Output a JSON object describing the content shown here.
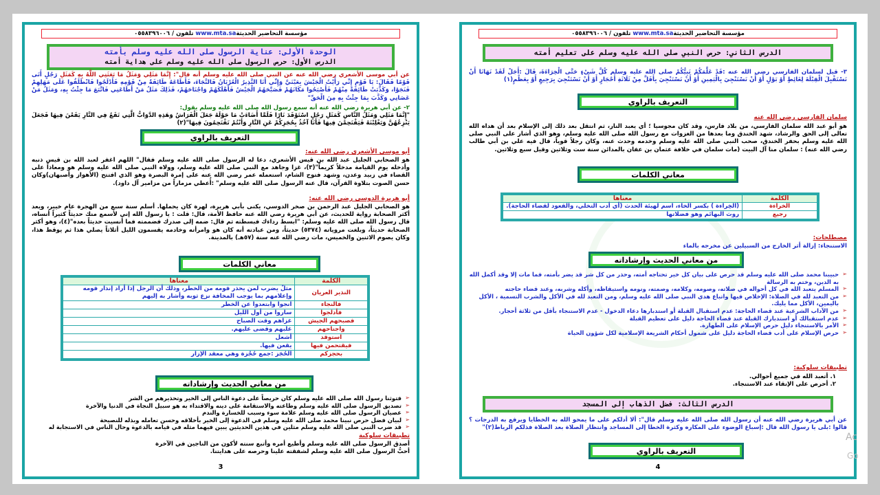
{
  "header": {
    "site": "www.mta.sa",
    "text": "مؤسسة التحاضير الحديثة",
    "phone": "تلفون / ٠٥٥٨٣٩٦٠٠٦"
  },
  "left_page": {
    "unit_title": "الوحدة الأولى: عناية الرسول صلى الله عليه وسلم بأمته",
    "unit_label": "الوحدة الأولى:",
    "lesson_title": "الدرس الأول: حرص الرسول صلى الله عليه وسلم على هداية أمته",
    "hadith1_intro": "عن أبي موسى الأشعري رضي الله عنه عن النبي صلى الله عليه وسلم أنه قال\": إِنَّمَا مَثَلِي وَمَثَلُ مَا بَعَثَنِي اللَّهُ بِهِ كَمَثَلِ",
    "hadith1_body": "رَجُلٍ أَتَى قَوْمًا فَقَالَ: يَا قَوْمِ إِنِّي رَأَيْتُ الْجَيْشَ بِعَيْنَيَّ وَإِنِّي أَنَا النَّذِيرُ الْعُرْيَانُ فَالنَّجَاءَ، فَأَطَاعَهُ طَائِفَةٌ مِنْ قَوْمِهِ فَأَدْلَجُوا فَانْطَلَقُوا عَلَى مَهَلِهِمْ فَنَجَوْا، وَكَذَّبَتْ طَائِفَةٌ مِنْهُمْ فَأَصْبَحُوا مَكَانَهُمْ فَصَبَّحَهُمُ الْجَيْشُ فَأَهْلَكَهُمْ وَاجْتَاحَهُمْ، فَذَلِكَ مَثَلُ مَنْ أَطَاعَنِي فَاتَّبَعَ مَا جِئْتُ بِهِ، وَمَثَلُ مَنْ عَصَانِي وَكَذَّبَ بِمَا جِئْتُ بِهِ مِنَ الْحَقِّ\"",
    "hadith2_intro": "٢- عن أبي هريرة رضي الله عنه أنه سمع رسول الله صلى الله عليه وسلم يقول:",
    "hadith2_body": "\"إِنَّمَا مَثَلِي وَمَثَلُ النَّاسِ كَمَثَلِ رَجُلٍ اسْتَوْقَدَ نَارًا فَلَمَّا أَضَاءَتْ مَا حَوْلَهُ جَعَلَ الْفَرَاشُ وَهَذِهِ الدَّوَابُّ الَّتِي تَقَعُ فِي النَّارِ يَقَعْنَ فِيهَا فَجَعَلَ يَنْزِعُهُنَّ وَيَغْلِبْنَهُ فَيَقْتَحِمْنَ فِيهَا فَأَنَا آخُذُ بِحُجَزِكُمْ عَنِ النَّارِ وَأَنْتُمْ تَقْتَحِمُونَ فِيهَا\"(٢)",
    "narrator_title": "التعريف بالراوي",
    "narrator1_name": "أبو موسى الأشعري رضي الله عنه:",
    "narrator1_text": "هو الصحابي الجليل عبد الله بن قيس الأشعري، دعا له الرسول صلى الله عليه وسلم فقال\" اللهم اغفر لعبد الله بن قيس ذنبه وأدخله يوم القيامة مدخلاً كريماً\"(٣)، غزا وجاهد مع النبي صلى الله عليه وسلم، وولاه النبي صلى الله عليه وسلم هو ومعاذاً على القضاء في زبيد وعدن، وشهد فتوح الشام، استعمله عمر رضي الله عنه على إمرة البصرة وهو الذي افتتح (الأهواز وأصبهان)وكان حسن الصوت بتلاوة القرآن، قال عنه الرسول صلى الله عليه وسلم\" :أُعطي مزماراً من مزامير آل داود).",
    "narrator2_name": "أبو هريرة الدوسي رضي الله عنه:",
    "narrator2_text": "هو الصحابي الجليل عبد الرحمن بن صخر الدوسي، يكنى بأبي هريرة، لهرة كان يحملها. أسلم سنة سبع من الهجرة عام خيبر، ويعد أكثر الصحابة رواية للحديث، عن أبي هريرة رضي الله عنه حافظ الأمة، قال: قلت : يا رسول الله إني لأسمع منك حديثاً كثيراً أنساه، قال رسول الله صلى الله عليه وسلم: \"ابسط رداءك فبسطته ثم قال: ضمه إلى صدرك فضممته فما أنسيت حديثاً بعده\"(٤)، وهو أكثر الصحابة حديثاً، وبلغت مروياته (٥٣٧٤) حديثاً، ومن عبادته أنه كان هو وامرأته وخادمه يقسمون الليل أثلاثاً يصلي هذا ثم يوقظ هذا، وكان يصوم الاثنين والخميس، مات رضي الله عنه سنة (٥٧هـ) بالمدينة.",
    "vocab_title": "معاني الكلمات",
    "vocab_headers": {
      "word": "الكلمة",
      "meaning": "معناها"
    },
    "vocab": [
      {
        "word": "النذير العريان",
        "meaning": "مثلٌ يضرب لمن يحذر قومه من الخطر، وذلك أن الرجل إذا أراد إنذار قومه وإعلامهم بما يوجب المخافة نزع ثوبه وأشار به إليهم"
      },
      {
        "word": "فالنجاء",
        "meaning": "انجوا وابتعدوا عن الخطر"
      },
      {
        "word": "فأدلجوا",
        "meaning": "ساروا من أول الليل"
      },
      {
        "word": "فصبحهم الجيش",
        "meaning": "غزاهم وقت الصباح"
      },
      {
        "word": "واجتاحهم",
        "meaning": "غلبهم وقضى عليهم."
      },
      {
        "word": "استوقد",
        "meaning": "أشعل"
      },
      {
        "word": "فيقتحمن فيها",
        "meaning": "يقعن فيها."
      },
      {
        "word": "بحجزكم",
        "meaning": "الحُجَز :جمع حُجْزة وهي معقد الإزار"
      }
    ],
    "guidance_title": "من معاني الحديث وإرشاداته",
    "guidance": [
      "فتوثنا رسول الله صلى الله عليه وسلم كان حريصاً على دعوة الناس إلى الخير وتحذيرهم من الشر",
      "تصديق الرسول صلى الله عليه وسلم وطاعته والاستقامة على دينه والاقتداء به هو سبيل النجاة في الدنيا والآخرة",
      "عصيان الرسول صلى الله عليه وسلم علامة سوء وسبب للخسارة والندم",
      "لبيان فضل حرص نبينا محمد صلى الله عليه وسلم في الدعوة إلى الخير بأخلاقه وحسن تعامله وبذله للنصيحة",
      "قد ضرب النبي صلى الله عليه وسلم مثلين في هذين الحديثين يبين فيهما مثله في قيامه بالدعوة وحال الناس في الاستجابة له"
    ],
    "applications_title": "تطبيقات سلوكية",
    "applications": [
      "أصدق الرسول صلى الله عليه وسلم وأطيع أمره وأتبع سنته لأكون من الناجين في الآخرة",
      "أحبُّ الرسول صلى الله عليه وسلم لشفقته علينا وحرصه على هدايتنا."
    ],
    "page_number": "3"
  },
  "right_page": {
    "lesson2_title": "الدرس الثاني: حرص النبي صلى الله عليه وسلم على تعليم أمته",
    "hadith3": "٣- قيل لسلمان الفارسي رضي الله عنه :قَدْ عَلَّمَكُمْ نَبِيُّكُمْ صلى الله عليه وسلم كُلَّ شَيْءٍ حَتَّى الْخِرَاءَةَ، قَالَ :أَجَلْ لَقَدْ نَهَانَا أَنْ نَسْتَقْبِلَ الْقِبْلَةَ لِغَائِطٍ أَوْ بَوْلٍ أَوْ أَنْ نَسْتَنْجِيَ بِالْيَمِينِ أَوْ أَنْ نَسْتَنْجِيَ بِأَقَلَّ مِنْ ثَلَاثَةِ أَحْجَارٍ أَوْ أَنْ نَسْتَنْجِيَ بِرَجِيعٍ أَوْ بِعَظْمٍ(١)",
    "narrator_title": "التعريف بالراوي",
    "narrator3_name": "سلمان الفارسي رضي الله عنه",
    "narrator3_text": "هو أبو عبد الله سلمان الفارسي، من بلاد فارس، وقد كان مجوسيا ؛ أي يعبد النار، ثم انتقل بعد ذلك إلى الإسلام بعد أن هداه الله تعالى إلى الحق والرشاد، شهد الخندق وما بعدها من الغزوات مع رسول الله صلى الله عليه وسلم، وهو الذي أشار على النبي صلى الله عليه وسلم بحفر الخندق، صحب النبي صلى الله عليه وسلم وخدمه وحدث عنه، وكان رجلاً قوياً، قال فيه علي بن أبي طالب رضي الله عنه) : سلمان منا آل البيت (مات سلمان في خلافة عثمان بن عفان بالمدائن سنة ست وثلاثين وقيل سبع وثلاثين.",
    "vocab_title": "معاني الكلمات",
    "vocab_headers": {
      "word": "الكلمة",
      "meaning": "معناها"
    },
    "vocab": [
      {
        "word": "الخراءة",
        "meaning": "(الخِراءة ) بكسر الخاء، اسم لهيئة الحدث (أي أدب التخلي، والقعود لقضاء الحاجة)."
      },
      {
        "word": "رجيع",
        "meaning": "روث البهائم وهو فضلاتها"
      }
    ],
    "terms_title": "مصطلحات:",
    "terms_text": "الاستنجاء: إزالة أثر الخارج من السبيلين عن مخرجه بالماء",
    "guidance_title": "من معاني الحديث وإرشاداته",
    "guidance": [
      "حبيبنا محمد صلى الله عليه وسلم قد حرص على بيان كل خير تحتاجه أمته، وحذر من كل شر قد يضر بأمته، فما مات إلا وقد أكمل الله به الدين، وختم به الرسالة",
      "المسلم يتعبد الله في كل أحواله في صلاته، وصومه، وكلامه، وصمته، ونومه واستيقاظه، وأكله وشربه، وعند قضاء حاجته",
      "من التعبد لله في الصلاة: الإخلاص فيها واتباع هدي النبي صلى الله عليه وسلم، ومن التعبد لله في الأكل والشرب التسمية ، الأكل باليمين، الأكل مما يليك.",
      "من الآداب الشرعية عند قضاء الحاجة: عدم استقبال القبلة أو استدبارها دعاء الدخول - عدم الاستنجاء بأقل من ثلاثة أحجار.",
      "عدم استقبالك أو استدبارك القبلة عند قضاء الحاجة دليل على تعظيم القبلة",
      "الأمر بالاستنجاء دليل حرص الإسلام على الطهارة.",
      "حرص الإسلام على أدب قضاء الحاجة دليل على شمول أحكام الشريعة الإسلامية لكل شؤون الحياة"
    ],
    "applications_title": "تطبيقات سلوكية:",
    "applications": [
      "١. أتعبد الله في جميع أحوالي.",
      "٢. أحرص على الإنقاء عند الاستنجاء."
    ],
    "lesson3_title": "الدرس الثالث: فضل الذهاب إلى المسجد",
    "hadith4": "عن أبي هريرة رضي الله عنه أن رسول الله صلى الله عليه وسلم قال\": ألا أدلكم على ما يمحو الله به الخطايا ويرفع به الدرجات ؟ قالوا :بلى يا رسول الله قال :إسباغ الوضوء على المكاره وكثرة الخطا إلى المساجد وانتظار الصلاة بعد الصلاة فذلكم الرباط(٢)\"",
    "narrator_title2": "التعريف بالراوي",
    "page_number": "4"
  },
  "overlay": {
    "line1": "Ac",
    "line2": "Go"
  }
}
